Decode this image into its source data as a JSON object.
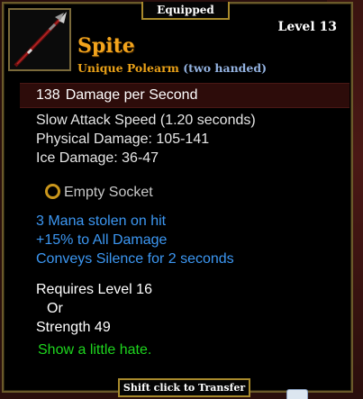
{
  "header": {
    "equipped_label": "Equipped",
    "level_label": "Level 13"
  },
  "item": {
    "icon": "polearm-icon",
    "name": "Spite",
    "rarity_type": "Unique Polearm",
    "handedness": "(two handed)",
    "name_color": "#f3a41c"
  },
  "dps": {
    "value": "138",
    "label": "Damage per Second"
  },
  "stats": [
    "Slow Attack Speed (1.20 seconds)",
    "Physical Damage: 105-141",
    "Ice Damage: 36-47"
  ],
  "socket": {
    "label": "Empty Socket",
    "icon": "socket-ring-icon"
  },
  "modifiers": [
    "3 Mana stolen on hit",
    "+15% to All Damage",
    "Conveys Silence for 2 seconds"
  ],
  "modifier_color": "#3c97f2",
  "requirements": {
    "level": "Requires Level 16",
    "or": "Or",
    "strength": "Strength 49"
  },
  "flavor_text": "Show a little hate.",
  "flavor_color": "#1ed61e",
  "footer": {
    "transfer_label": "Shift  click to Transfer"
  }
}
